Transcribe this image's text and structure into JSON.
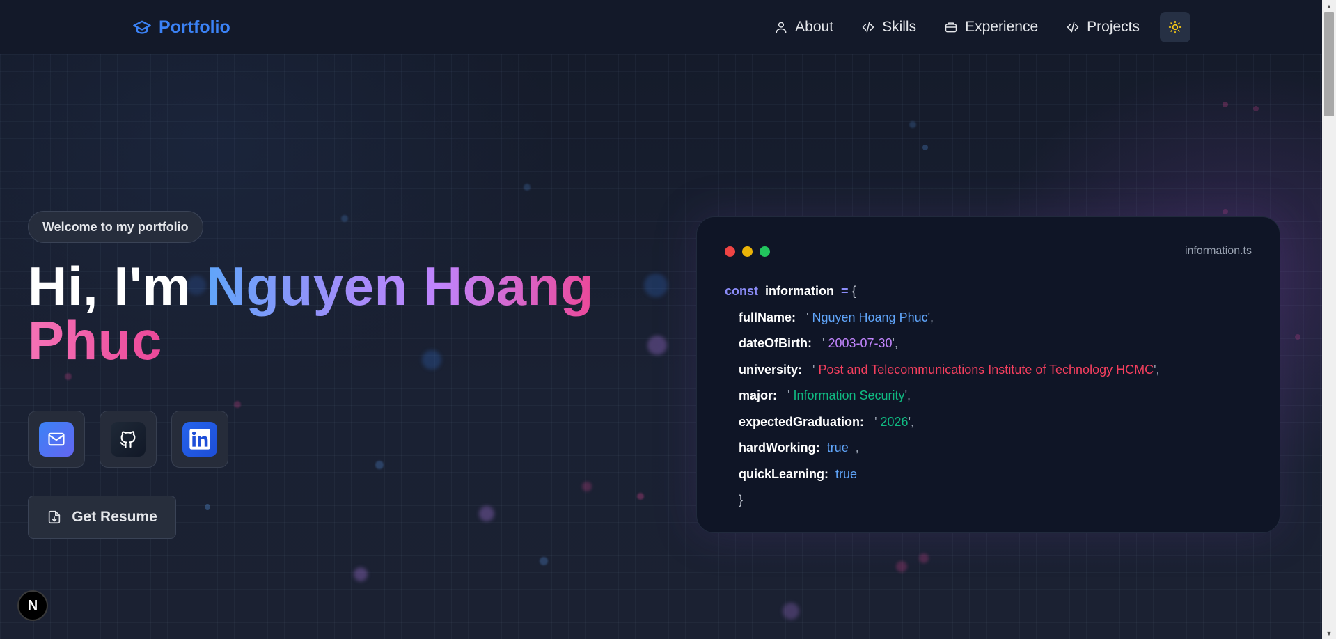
{
  "header": {
    "brand": "Portfolio",
    "nav": [
      {
        "label": "About",
        "icon": "user-icon"
      },
      {
        "label": "Skills",
        "icon": "code-icon"
      },
      {
        "label": "Experience",
        "icon": "briefcase-icon"
      },
      {
        "label": "Projects",
        "icon": "code-icon"
      }
    ],
    "theme_icon": "sun-icon"
  },
  "hero": {
    "badge": "Welcome to my portfolio",
    "greeting": "Hi, I'm",
    "name": "Nguyen Hoang",
    "last_name": "Phuc",
    "socials": [
      {
        "name": "mail",
        "icon": "mail-icon"
      },
      {
        "name": "github",
        "icon": "github-icon"
      },
      {
        "name": "linkedin",
        "icon": "linkedin-icon"
      }
    ],
    "resume_label": "Get Resume"
  },
  "code_card": {
    "filename": "information.ts",
    "const_kw": "const",
    "var_name": "information",
    "eq": "=",
    "open": "{",
    "close": "}",
    "fields": [
      {
        "key": "fullName:",
        "value": "Nguyen Hoang Phuc"
      },
      {
        "key": "dateOfBirth:",
        "value": "2003-07-30"
      },
      {
        "key": "university:",
        "value": "Post and Telecommunications Institute of Technology HCMC"
      },
      {
        "key": "major:",
        "value": "Information Security"
      },
      {
        "key": "expectedGraduation:",
        "value": "2026"
      },
      {
        "key": "hardWorking:",
        "value": "true"
      },
      {
        "key": "quickLearning:",
        "value": "true"
      }
    ]
  },
  "n_badge": "N",
  "colors": {
    "accent": "#3b82f6",
    "string_blue": "#60a5fa",
    "string_purple": "#c084fc",
    "string_red": "#f43f5e",
    "string_green": "#10b981"
  }
}
